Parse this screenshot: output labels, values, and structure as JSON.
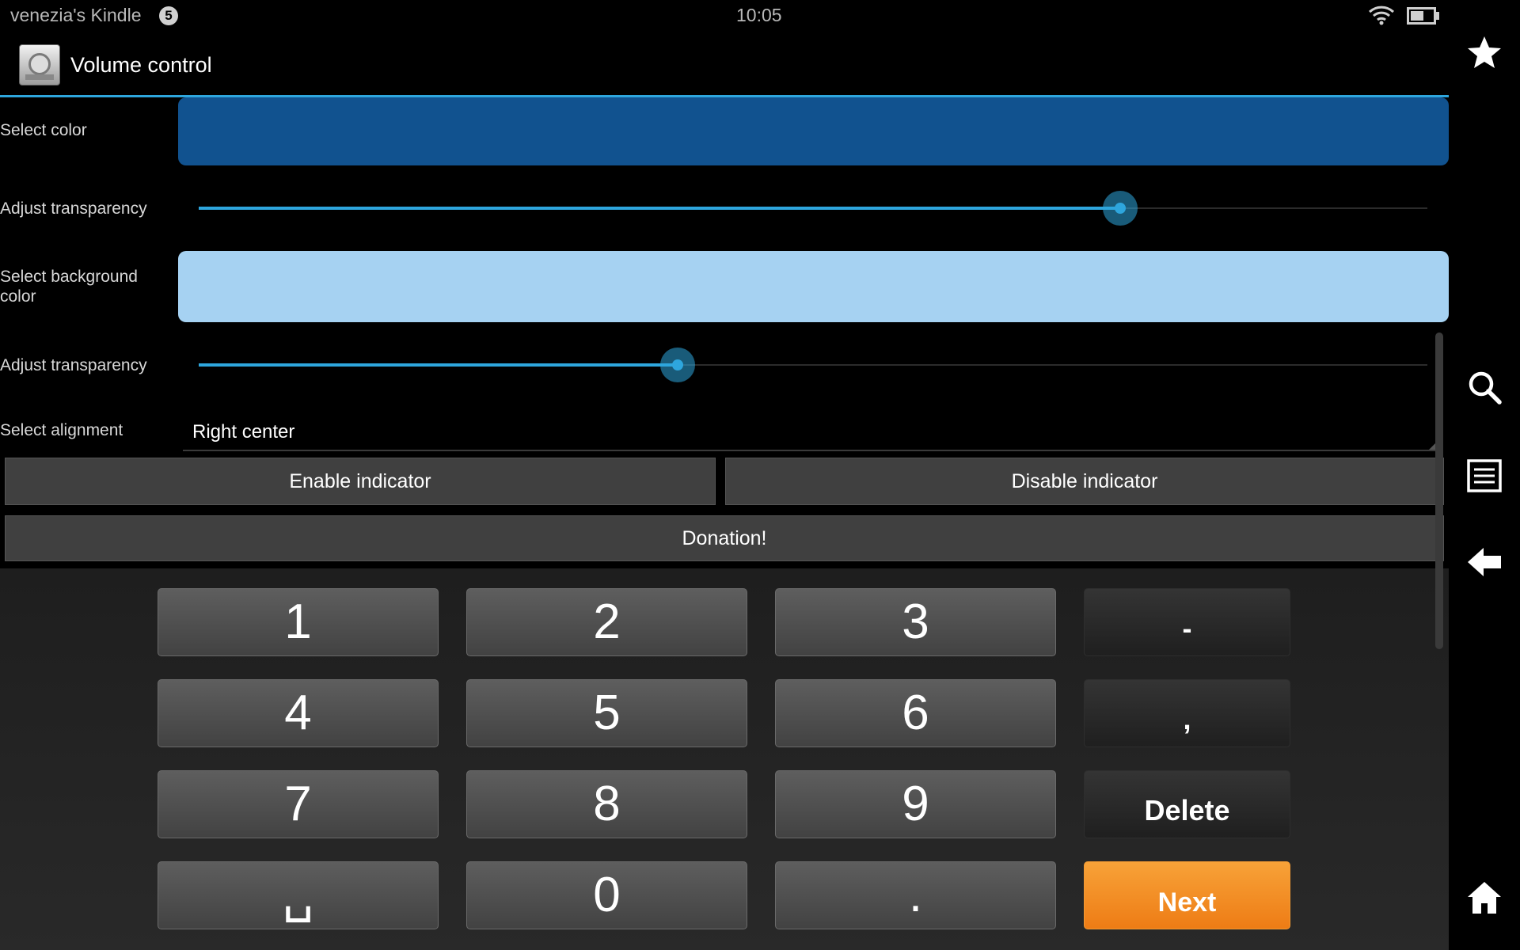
{
  "status_bar": {
    "device_name": "venezia's Kindle",
    "notification_count": "5",
    "time": "10:05"
  },
  "app": {
    "title": "Volume control"
  },
  "settings": {
    "color_label": "Select color",
    "color_value": "#11528f",
    "transparency_label": "Adjust transparency",
    "transparency_value": 0.75,
    "bg_color_label": "Select background color",
    "bg_color_value": "#a6d2f2",
    "bg_transparency_label": "Adjust transparency",
    "bg_transparency_value": 0.39,
    "alignment_label": "Select alignment",
    "alignment_value": "Right center"
  },
  "buttons": {
    "enable": "Enable indicator",
    "disable": "Disable indicator",
    "donation": "Donation!"
  },
  "keyboard": {
    "rows": [
      [
        "1",
        "2",
        "3",
        "-"
      ],
      [
        "4",
        "5",
        "6",
        ","
      ],
      [
        "7",
        "8",
        "9",
        "Delete"
      ],
      [
        "␣",
        "0",
        ".",
        "Next"
      ]
    ]
  },
  "nav": {
    "icons": [
      "star-icon",
      "search-icon",
      "menu-icon",
      "back-icon",
      "home-icon"
    ]
  },
  "colors": {
    "accent": "#2ea6dd",
    "next_key": "#f28c22"
  }
}
